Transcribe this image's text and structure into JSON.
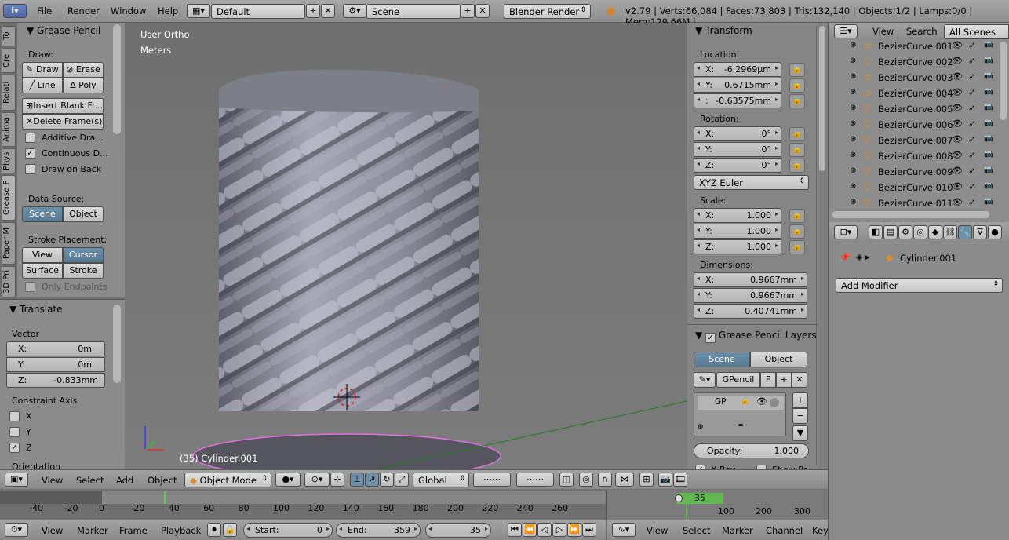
{
  "menubar": {
    "items": [
      "File",
      "Render",
      "Window",
      "Help"
    ],
    "layout": "Default",
    "scene": "Scene",
    "engine": "Blender Render",
    "stats": "v2.79 | Verts:66,084 | Faces:73,803 | Tris:132,140 | Objects:1/2 | Lamps:0/0 | Mem:129.66M |"
  },
  "tabs": [
    "To",
    "Cre",
    "Relati",
    "Anima",
    "Phys",
    "Grease P",
    "Paper M",
    "3D Pri"
  ],
  "grease_pencil": {
    "title": "Grease Pencil",
    "draw_label": "Draw:",
    "draw": "Draw",
    "erase": "Erase",
    "line": "Line",
    "poly": "Poly",
    "insert_blank": "Insert Blank Fr...",
    "delete_frames": "Delete Frame(s)",
    "additive": "Additive Dra...",
    "continuous": "Continuous D...",
    "draw_on_back": "Draw on Back",
    "data_source": "Data Source:",
    "scene": "Scene",
    "object": "Object",
    "stroke_placement": "Stroke Placement:",
    "view": "View",
    "cursor": "Cursor",
    "surface": "Surface",
    "stroke": "Stroke",
    "only_endpoints": "Only Endpoints"
  },
  "translate": {
    "title": "Translate",
    "vector": "Vector",
    "x_label": "X:",
    "x": "0m",
    "y_label": "Y:",
    "y": "0m",
    "z_label": "Z:",
    "z": "-0.833mm",
    "constraint": "Constraint Axis",
    "cx": "X",
    "cy": "Y",
    "cz": "Z",
    "orientation": "Orientation"
  },
  "viewport": {
    "view_name": "User Ortho",
    "units": "Meters",
    "object_info": "(35) Cylinder.001"
  },
  "transform": {
    "title": "Transform",
    "location": "Location:",
    "loc_x_label": "X:",
    "loc_x": "-6.2969µm",
    "loc_y_label": "Y:",
    "loc_y": "0.6715mm",
    "loc_z_label": ":",
    "loc_z": "-0.63575mm",
    "rotation": "Rotation:",
    "rot_x_label": "X:",
    "rot_x": "0°",
    "rot_y_label": "Y:",
    "rot_y": "0°",
    "rot_z_label": "Z:",
    "rot_z": "0°",
    "rot_mode": "XYZ Euler",
    "scale": "Scale:",
    "sc_x_label": "X:",
    "sc_x": "1.000",
    "sc_y_label": "Y:",
    "sc_y": "1.000",
    "sc_z_label": "Z:",
    "sc_z": "1.000",
    "dimensions": "Dimensions:",
    "dim_x_label": "X:",
    "dim_x": "0.9667mm",
    "dim_y_label": "Y:",
    "dim_y": "0.9667mm",
    "dim_z_label": "Z:",
    "dim_z": "0.40741mm"
  },
  "gp_layers": {
    "title": "Grease Pencil Layers",
    "scene": "Scene",
    "object": "Object",
    "gpencil": "GPencil",
    "f": "F",
    "layer": "GP",
    "opacity_label": "Opacity:",
    "opacity": "1.000",
    "xray": "X-Ray",
    "show_points": "Show Po..."
  },
  "outliner": {
    "view": "View",
    "search": "Search",
    "filter": "All Scenes",
    "items": [
      {
        "name": "BezierCurve.001",
        "kind": "curve"
      },
      {
        "name": "BezierCurve.002",
        "kind": "mesh"
      },
      {
        "name": "BezierCurve.003",
        "kind": "curve"
      },
      {
        "name": "BezierCurve.004",
        "kind": "curve"
      },
      {
        "name": "BezierCurve.005",
        "kind": "mesh"
      },
      {
        "name": "BezierCurve.006",
        "kind": "mesh"
      },
      {
        "name": "BezierCurve.007",
        "kind": "mesh"
      },
      {
        "name": "BezierCurve.008",
        "kind": "mesh"
      },
      {
        "name": "BezierCurve.009",
        "kind": "mesh"
      },
      {
        "name": "BezierCurve.010",
        "kind": "mesh"
      },
      {
        "name": "BezierCurve.011",
        "kind": "mesh"
      }
    ]
  },
  "properties": {
    "object_name": "Cylinder.001",
    "add_modifier": "Add Modifier"
  },
  "header3d": {
    "view": "View",
    "select": "Select",
    "add": "Add",
    "object": "Object",
    "mode": "Object Mode",
    "orientation": "Global"
  },
  "timeline": {
    "ticks": [
      "-40",
      "-20",
      "0",
      "20",
      "40",
      "60",
      "80",
      "100",
      "120",
      "140",
      "160",
      "180",
      "200",
      "220",
      "240",
      "260"
    ],
    "view": "View",
    "marker": "Marker",
    "frame": "Frame",
    "playback": "Playback",
    "start_label": "Start:",
    "start": "0",
    "end_label": "End:",
    "end": "359",
    "current": "35"
  },
  "graph": {
    "current": "35",
    "ticks": [
      "100",
      "200",
      "300"
    ],
    "view": "View",
    "select": "Select",
    "marker": "Marker",
    "channel": "Channel",
    "key": "Key"
  }
}
